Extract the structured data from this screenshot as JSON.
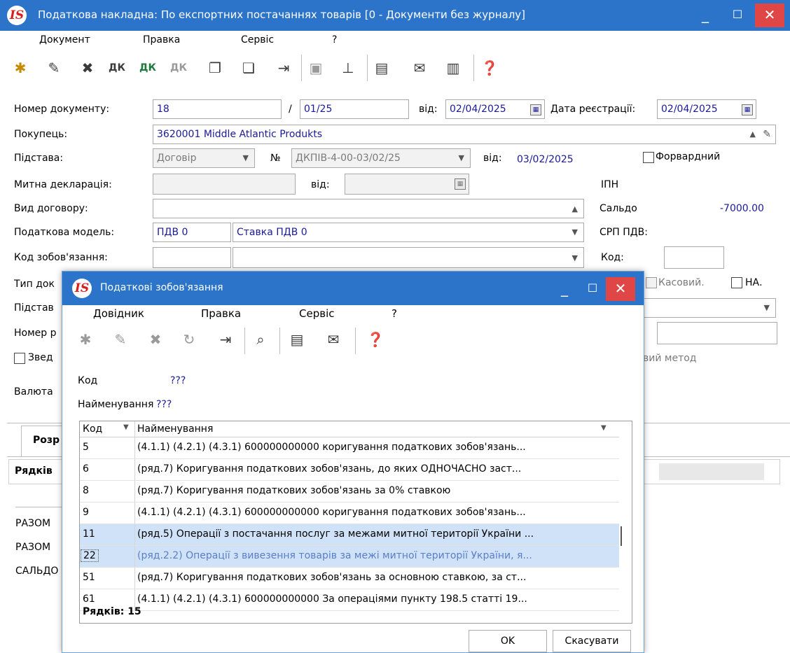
{
  "window": {
    "title": "Податкова накладна: По експортних  постачаннях товарів [0 - Документи без журналу]",
    "logo": "IS"
  },
  "menu": [
    "Документ",
    "Правка",
    "Сервіс",
    "?"
  ],
  "form": {
    "doc_number_label": "Номер документу:",
    "doc_number": "18",
    "slash": "/",
    "doc_suffix": "01/25",
    "date_from_label": "від:",
    "date_from": "02/04/2025",
    "reg_date_label": "Дата реєстрації:",
    "reg_date": "02/04/2025",
    "buyer_label": "Покупець:",
    "buyer_code": "3620001",
    "buyer_name": "Middle Atlantic Produkts",
    "basis_label": "Підстава:",
    "basis_value": "Договір",
    "no_label": "№",
    "contract_no": "ДКПІВ-4-00-03/02/25",
    "contract_date_label": "від:",
    "contract_date": "03/02/2025",
    "forward_label": "Форвардний",
    "customs_label": "Митна декларація:",
    "customs_date_label": "від:",
    "ipn_label": "ІПН",
    "contract_type_label": "Вид договору:",
    "saldo_label": "Сальдо",
    "saldo_value": "-7000.00",
    "tax_model_label": "Податкова модель:",
    "tax_model_code": "ПДВ  0",
    "tax_model_name": "Ставка ПДВ 0",
    "srp_label": "СРП ПДВ:",
    "obligation_code_label": "Код зобов'язання:",
    "code_label": "Код:",
    "doc_type_label_partial": "Тип док",
    "cash_label": "Касовий.",
    "na_label": "НА.",
    "basis2_label_partial": "Підстав",
    "number_label_partial": "Номер р",
    "consolidated_label_partial": "Звед",
    "method_label_partial": "вий метод",
    "currency_label_partial": "Валюта",
    "tab_partial": "Розр",
    "rows_label_partial": "Рядків",
    "total1": "РАЗОМ",
    "total2": "РАЗОМ",
    "saldo_row": "САЛЬДО"
  },
  "dialog": {
    "title": "Податкові зобов'язання",
    "menu": [
      "Довідник",
      "Правка",
      "Сервіс",
      "?"
    ],
    "code_label": "Код",
    "code_value": "???",
    "name_label": "Найменування",
    "name_value": "???",
    "col_code": "Код",
    "col_name": "Найменування",
    "rows": [
      {
        "code": "5",
        "name": "(4.1.1) (4.2.1) (4.3.1) 600000000000 коригування податкових зобов'язань..."
      },
      {
        "code": "6",
        "name": "(ряд.7) Коригування податкових зобов'язань, до яких ОДНОЧАСНО заст..."
      },
      {
        "code": "8",
        "name": "(ряд.7) Коригування податкових зобов'язань за 0% ставкою"
      },
      {
        "code": "9",
        "name": "(4.1.1) (4.2.1) (4.3.1) 600000000000 коригування податкових зобов'язань..."
      },
      {
        "code": "11",
        "name": "(ряд.5) Операції з постачання послуг за межами митної території України ..."
      },
      {
        "code": "22",
        "name": "(ряд.2.2) Операції з вивезення товарів за межі митної території України, я..."
      },
      {
        "code": "51",
        "name": "(ряд.7) Коригування податкових зобов'язань за основною ставкою, за ст..."
      },
      {
        "code": "61",
        "name": "(4.1.1) (4.2.1) (4.3.1) 600000000000 За операціями пункту 198.5 статті 19..."
      }
    ],
    "rows_count": "Рядків: 15",
    "ok": "OK",
    "cancel": "Скасувати"
  },
  "icons": {
    "main_toolbar": [
      "add-doc-icon",
      "edit-doc-icon",
      "delete-doc-icon",
      "dk-icon",
      "dk-up-icon",
      "dk-gray-icon",
      "doc-copy-icon",
      "doc-icon",
      "exit-icon",
      "save-icon",
      "hierarchy-icon",
      "form-icon",
      "mail-icon",
      "binders-icon",
      "help-icon"
    ],
    "dialog_toolbar": [
      "add-icon",
      "edit-icon",
      "delete-icon",
      "refresh-icon",
      "exit-icon",
      "search-icon",
      "form-icon",
      "mail-icon",
      "help-icon"
    ]
  },
  "colors": {
    "titlebar": "#2b74c9",
    "close": "#e04646",
    "selection": "#cfe2f8",
    "value": "#1a1a9a"
  }
}
